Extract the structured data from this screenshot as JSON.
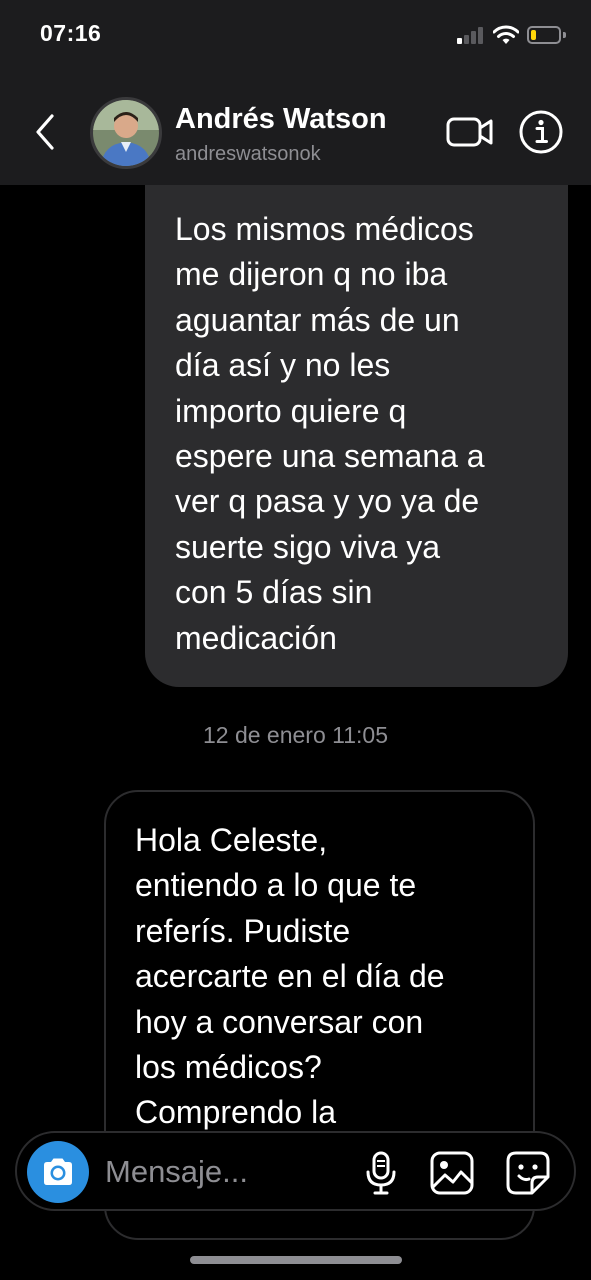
{
  "status_bar": {
    "time": "07:16",
    "signal_icon": "signal-icon",
    "wifi_icon": "wifi-icon",
    "battery_icon": "battery-low-icon",
    "battery_level": 0.2,
    "battery_color": "#ffd60a"
  },
  "header": {
    "back_icon": "chevron-left-icon",
    "contact_name": "Andrés Watson",
    "contact_handle": "andreswatsonok",
    "video_icon": "video-camera-icon",
    "info_icon": "info-icon"
  },
  "messages": [
    {
      "direction": "outgoing",
      "text": "Los mismos médicos\nme dijeron q no iba\naguantar más de un\ndía así y no les\nimporto quiere q\nespere una semana a\nver q pasa y yo ya de\nsuerte sigo viva ya\ncon 5 días sin\nmedicación"
    },
    {
      "direction": "incoming",
      "text": "Hola Celeste,\nentiendo a lo que te\nreferís. Pudiste\nacercarte en el día de\nhoy a conversar con\nlos médicos?\nComprendo la"
    }
  ],
  "timestamp": "12 de enero 11:05",
  "composer": {
    "camera_icon": "camera-icon",
    "placeholder": "Mensaje...",
    "mic_icon": "microphone-icon",
    "gallery_icon": "gallery-icon",
    "sticker_icon": "sticker-icon",
    "camera_color": "#2a8fe0"
  },
  "colors": {
    "background": "#000000",
    "header": "#1c1c1e",
    "bubble_outgoing": "#2c2c2e",
    "muted_text": "#8e8e93"
  }
}
